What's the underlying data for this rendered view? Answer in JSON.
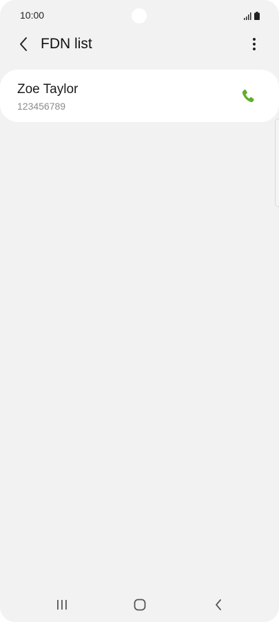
{
  "status_bar": {
    "time": "10:00",
    "icons": [
      "signal-icon",
      "battery-icon"
    ]
  },
  "app_bar": {
    "back_icon": "chevron-left-icon",
    "title": "FDN list",
    "more_icon": "more-vertical-icon"
  },
  "contacts": [
    {
      "name": "Zoe Taylor",
      "number": "123456789",
      "action_icon": "phone-icon"
    }
  ],
  "nav_bar": {
    "icons": [
      "recents-icon",
      "home-icon",
      "back-icon"
    ]
  },
  "colors": {
    "background": "#f2f2f2",
    "card": "#ffffff",
    "call_accent": "#5fae2a",
    "title_text": "#111111",
    "secondary_text": "#8a8a8a"
  }
}
